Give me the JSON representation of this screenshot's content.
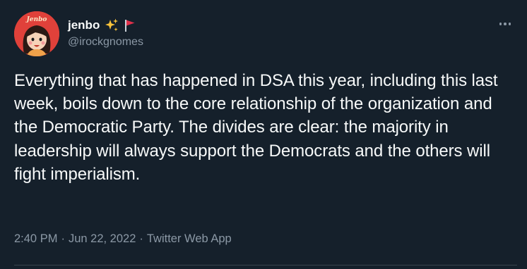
{
  "tweet": {
    "avatar_text": "Jenbo",
    "display_name": "jenbo",
    "handle": "@irockgnomes",
    "text": "Everything that has happened in DSA this year, including this last week, boils down to the core relationship of the organization and the Democratic Party. The divides are clear: the majority in leadership will always support the Democrats and the others will fight imperialism.",
    "time": "2:40 PM",
    "date": "Jun 22, 2022",
    "source": "Twitter Web App",
    "separator": "·"
  },
  "icons": {
    "sparkles": "sparkles-icon",
    "flag": "red-flag-icon",
    "more": "more-icon"
  },
  "colors": {
    "background": "#15202b",
    "primary_text": "#f7f9f9",
    "secondary_text": "#8b98a5",
    "avatar_bg": "#e0413a",
    "divider": "#38444d"
  }
}
